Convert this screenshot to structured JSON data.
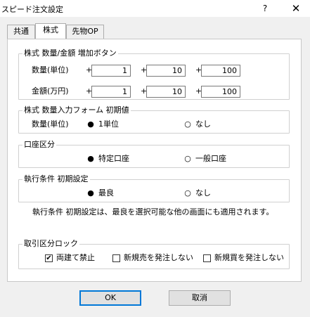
{
  "window": {
    "title": "スピード注文設定",
    "help_label": "?",
    "close_label": "✕"
  },
  "tabs": [
    {
      "label": "共通"
    },
    {
      "label": "株式"
    },
    {
      "label": "先物OP"
    }
  ],
  "increment_group": {
    "title": "株式 数量/金額 増加ボタン",
    "quantity_label": "数量(単位)",
    "amount_label": "金額(万円)",
    "plus": "+",
    "quantity_values": [
      "1",
      "10",
      "100"
    ],
    "amount_values": [
      "1",
      "10",
      "100"
    ]
  },
  "initial_qty_group": {
    "title": "株式 数量入力フォーム 初期値",
    "label": "数量(単位)",
    "options": [
      {
        "label": "1単位",
        "selected": true
      },
      {
        "label": "なし",
        "selected": false
      }
    ]
  },
  "account_group": {
    "title": "口座区分",
    "options": [
      {
        "label": "特定口座",
        "selected": true
      },
      {
        "label": "一般口座",
        "selected": false
      }
    ]
  },
  "exec_group": {
    "title": "執行条件 初期設定",
    "options": [
      {
        "label": "最良",
        "selected": true
      },
      {
        "label": "なし",
        "selected": false
      }
    ],
    "note": "執行条件 初期設定は、最良を選択可能な他の画面にも適用されます。"
  },
  "lock_group": {
    "title": "取引区分ロック",
    "checks": [
      {
        "label": "両建て禁止",
        "checked": true
      },
      {
        "label": "新規売を発注しない",
        "checked": false
      },
      {
        "label": "新規買を発注しない",
        "checked": false
      }
    ]
  },
  "buttons": {
    "ok": "OK",
    "cancel": "取消"
  },
  "symbols": {
    "radio_on": "●",
    "radio_off": "○",
    "check_on": "✔"
  }
}
